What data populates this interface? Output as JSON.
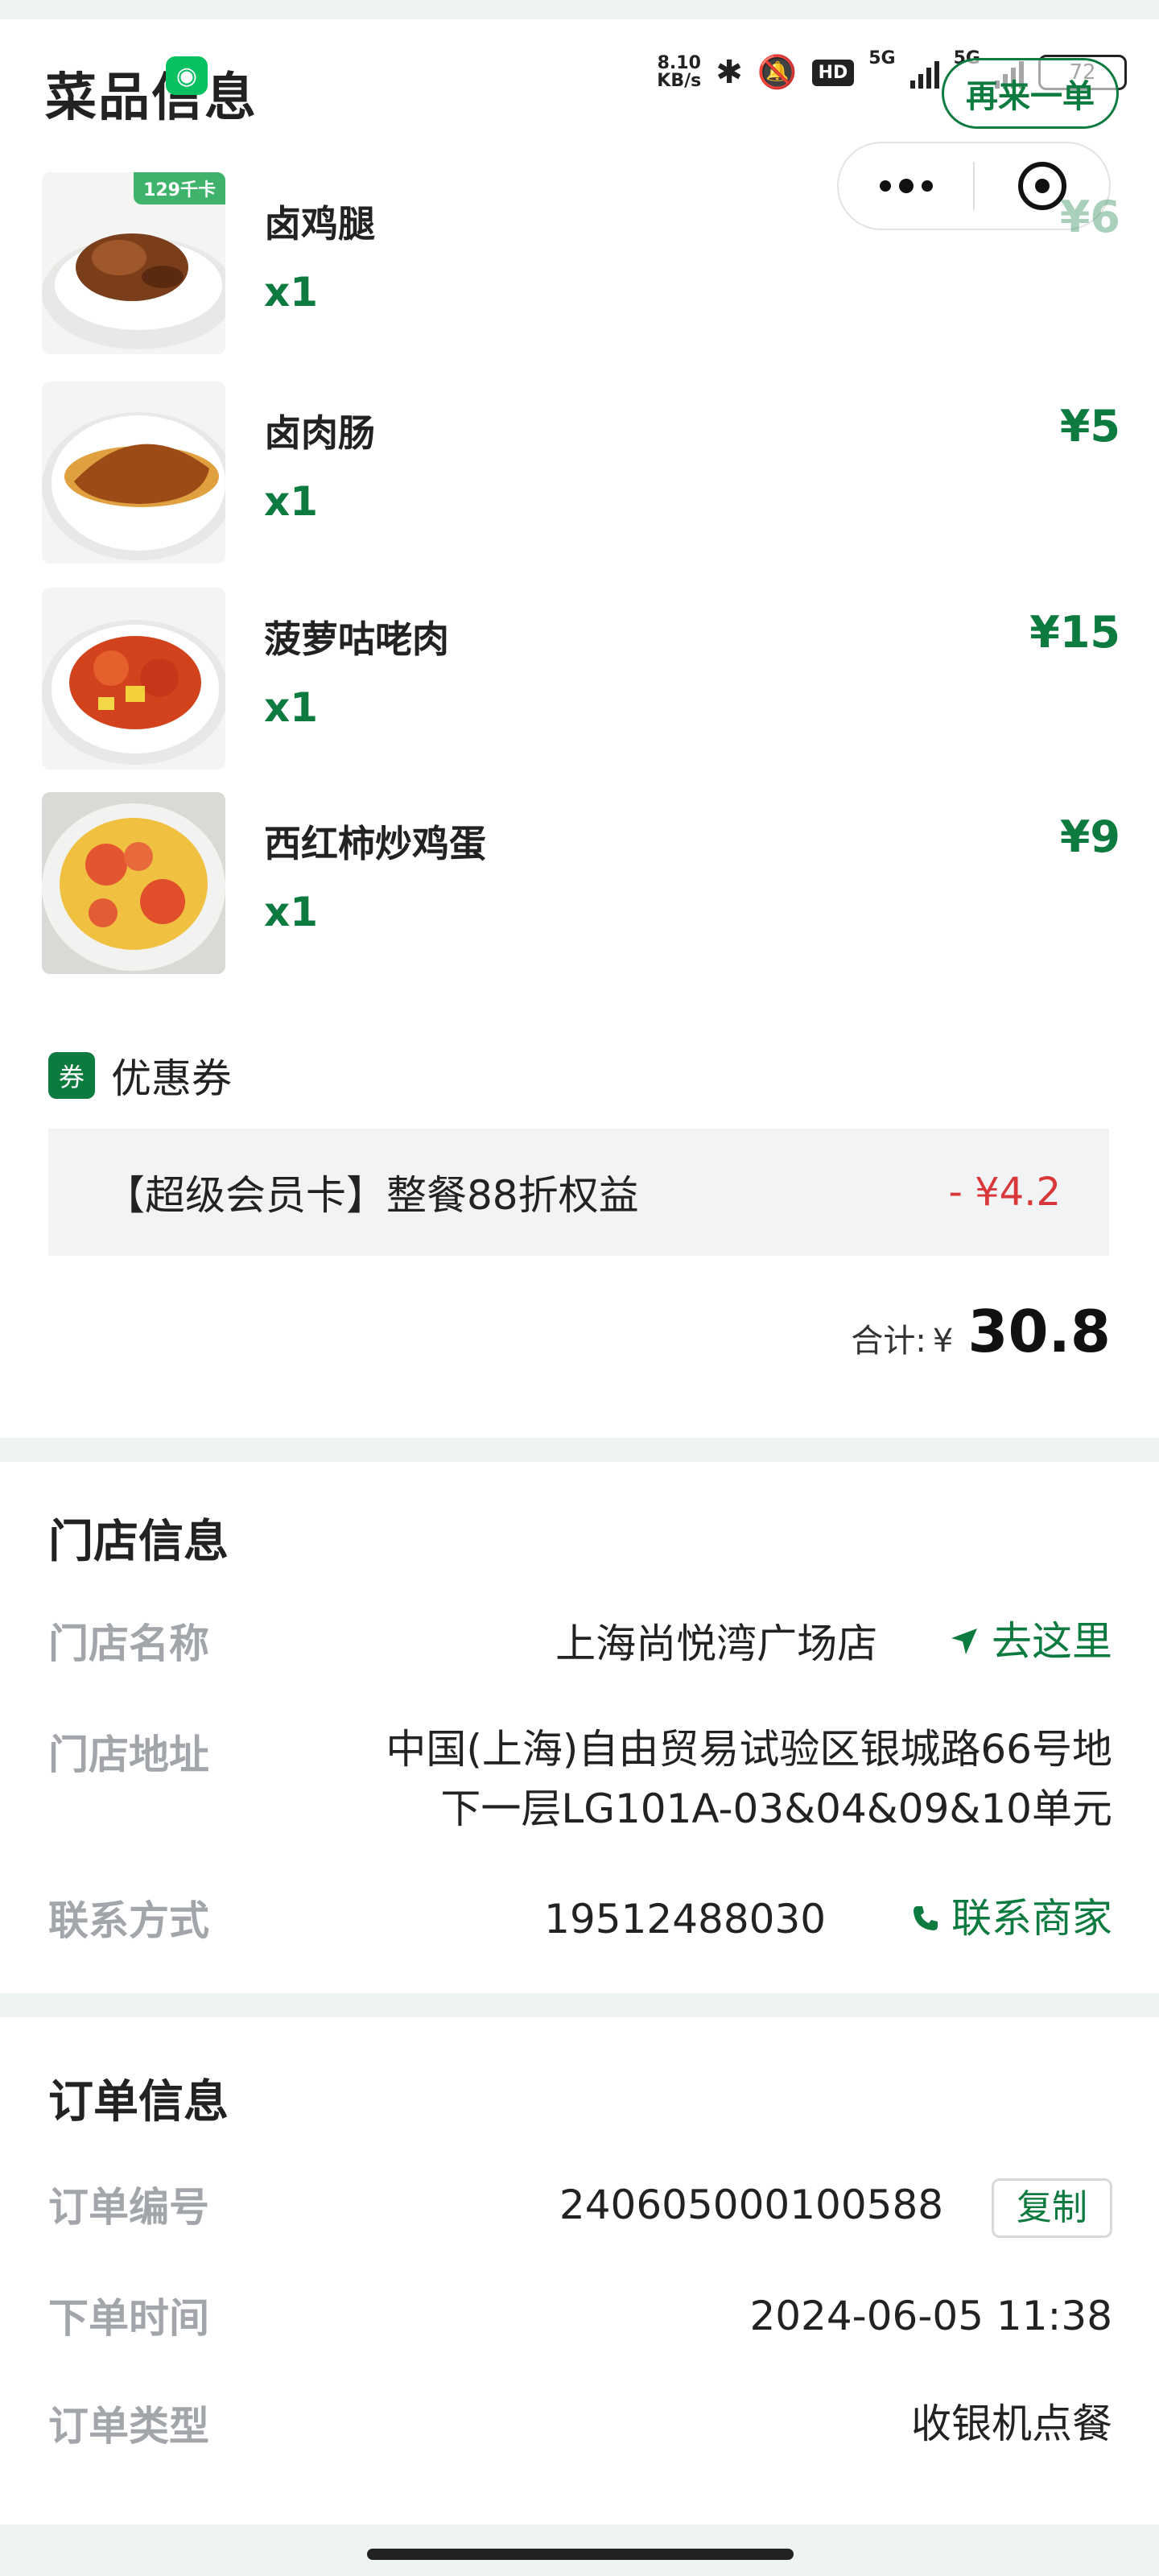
{
  "status_bar": {
    "net_speed_value": "8.10",
    "net_speed_unit": "KB/s",
    "hd_label": "HD",
    "signal_1": "5G",
    "signal_2": "5G",
    "battery": "72"
  },
  "header": {
    "title": "菜品信息",
    "reorder_label": "再来一单"
  },
  "dishes": [
    {
      "name": "卤鸡腿",
      "qty": "x1",
      "price": "¥6",
      "badge": "129千卡"
    },
    {
      "name": "卤肉肠",
      "qty": "x1",
      "price": "¥5"
    },
    {
      "name": "菠萝咕咾肉",
      "qty": "x1",
      "price": "¥15"
    },
    {
      "name": "西红柿炒鸡蛋",
      "qty": "x1",
      "price": "¥9"
    }
  ],
  "coupon": {
    "badge": "券",
    "title": "优惠券",
    "text": "【超级会员卡】整餐88折权益",
    "amount": "- ¥4.2"
  },
  "total": {
    "label": "合计:",
    "currency": "¥",
    "value": "30.8"
  },
  "store": {
    "title": "门店信息",
    "name_label": "门店名称",
    "name": "上海尚悦湾广场店",
    "go_label": "去这里",
    "address_label": "门店地址",
    "address_line1": "中国(上海)自由贸易试验区银城路66号地",
    "address_line2": "下一层LG101A-03&04&09&10单元",
    "contact_label": "联系方式",
    "phone": "19512488030",
    "call_label": "联系商家"
  },
  "order": {
    "title": "订单信息",
    "number_label": "订单编号",
    "number": "240605000100588",
    "copy_label": "复制",
    "time_label": "下单时间",
    "time": "2024-06-05 11:38",
    "type_label": "订单类型",
    "type": "收银机点餐"
  },
  "colors": {
    "accent": "#0d7a3f",
    "discount": "#d9383a",
    "muted_label": "#a2a6ab",
    "page_bg": "#eef3f4"
  }
}
